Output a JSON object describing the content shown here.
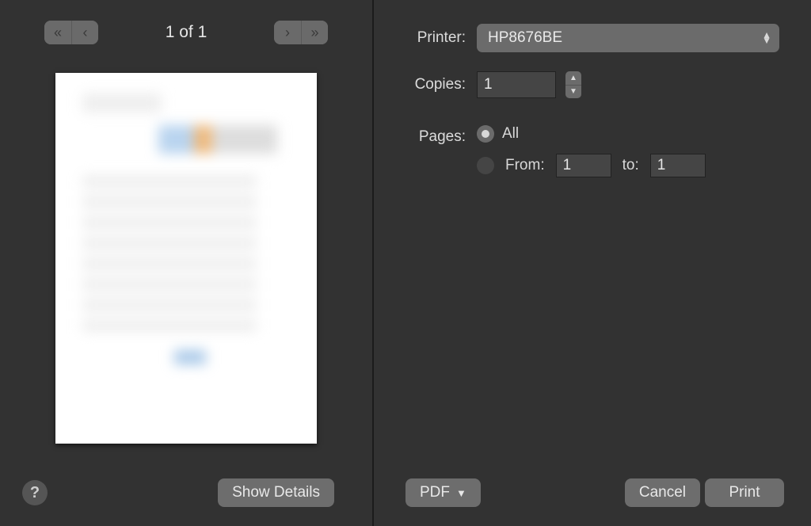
{
  "preview": {
    "page_indicator": "1 of 1",
    "show_details_label": "Show Details",
    "help_glyph": "?"
  },
  "form": {
    "printer_label": "Printer:",
    "printer_value": "HP8676BE",
    "copies_label": "Copies:",
    "copies_value": "1",
    "pages_label": "Pages:",
    "pages_all_label": "All",
    "pages_from_label": "From:",
    "pages_to_label": "to:",
    "pages_from_value": "1",
    "pages_to_value": "1"
  },
  "footer": {
    "pdf_label": "PDF",
    "cancel_label": "Cancel",
    "print_label": "Print"
  }
}
